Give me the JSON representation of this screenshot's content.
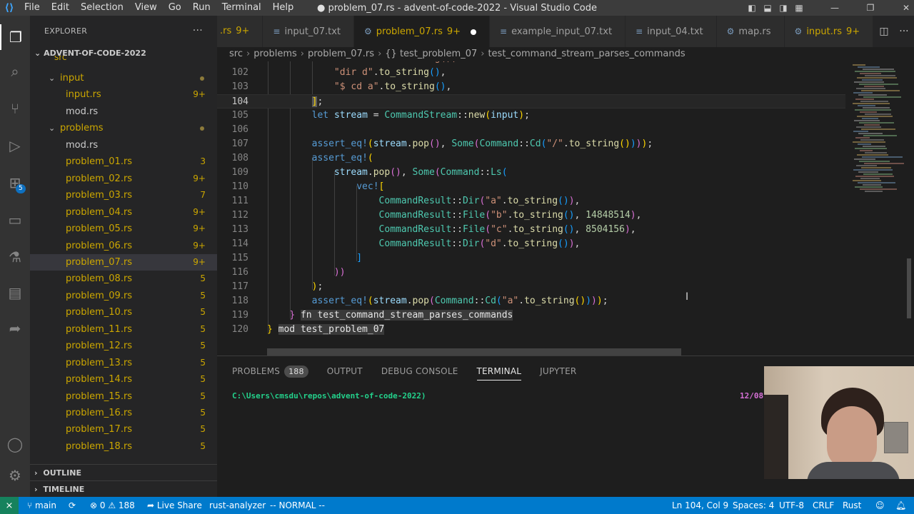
{
  "window": {
    "title": "● problem_07.rs - advent-of-code-2022 - Visual Studio Code",
    "menu": [
      "File",
      "Edit",
      "Selection",
      "View",
      "Go",
      "Run",
      "Terminal",
      "Help"
    ]
  },
  "explorer": {
    "header": "EXPLORER",
    "more": "···",
    "root": "ADVENT-OF-CODE-2022",
    "partial_top": "src",
    "rows": [
      {
        "name": "input",
        "kind": "folder",
        "indent": 1,
        "count": "",
        "warn": true
      },
      {
        "name": "input.rs",
        "kind": "file",
        "indent": 2,
        "count": "9+",
        "warn": true
      },
      {
        "name": "mod.rs",
        "kind": "file",
        "indent": 2,
        "count": "",
        "warn": false
      },
      {
        "name": "problems",
        "kind": "folder",
        "indent": 1,
        "count": "",
        "warn": true
      },
      {
        "name": "mod.rs",
        "kind": "file",
        "indent": 2,
        "count": "",
        "warn": false
      },
      {
        "name": "problem_01.rs",
        "kind": "file",
        "indent": 2,
        "count": "3",
        "warn": true
      },
      {
        "name": "problem_02.rs",
        "kind": "file",
        "indent": 2,
        "count": "9+",
        "warn": true
      },
      {
        "name": "problem_03.rs",
        "kind": "file",
        "indent": 2,
        "count": "7",
        "warn": true
      },
      {
        "name": "problem_04.rs",
        "kind": "file",
        "indent": 2,
        "count": "9+",
        "warn": true
      },
      {
        "name": "problem_05.rs",
        "kind": "file",
        "indent": 2,
        "count": "9+",
        "warn": true
      },
      {
        "name": "problem_06.rs",
        "kind": "file",
        "indent": 2,
        "count": "9+",
        "warn": true
      },
      {
        "name": "problem_07.rs",
        "kind": "file",
        "indent": 2,
        "count": "9+",
        "warn": true,
        "selected": true
      },
      {
        "name": "problem_08.rs",
        "kind": "file",
        "indent": 2,
        "count": "5",
        "warn": true
      },
      {
        "name": "problem_09.rs",
        "kind": "file",
        "indent": 2,
        "count": "5",
        "warn": true
      },
      {
        "name": "problem_10.rs",
        "kind": "file",
        "indent": 2,
        "count": "5",
        "warn": true
      },
      {
        "name": "problem_11.rs",
        "kind": "file",
        "indent": 2,
        "count": "5",
        "warn": true
      },
      {
        "name": "problem_12.rs",
        "kind": "file",
        "indent": 2,
        "count": "5",
        "warn": true
      },
      {
        "name": "problem_13.rs",
        "kind": "file",
        "indent": 2,
        "count": "5",
        "warn": true
      },
      {
        "name": "problem_14.rs",
        "kind": "file",
        "indent": 2,
        "count": "5",
        "warn": true
      },
      {
        "name": "problem_15.rs",
        "kind": "file",
        "indent": 2,
        "count": "5",
        "warn": true
      },
      {
        "name": "problem_16.rs",
        "kind": "file",
        "indent": 2,
        "count": "5",
        "warn": true
      },
      {
        "name": "problem_17.rs",
        "kind": "file",
        "indent": 2,
        "count": "5",
        "warn": true
      },
      {
        "name": "problem_18.rs",
        "kind": "file",
        "indent": 2,
        "count": "5",
        "warn": true
      }
    ],
    "sections": [
      "OUTLINE",
      "TIMELINE"
    ]
  },
  "tabs": [
    {
      "label": ".rs",
      "count": "9+",
      "active": false,
      "warn": true
    },
    {
      "label": "input_07.txt",
      "count": "",
      "active": false,
      "warn": false
    },
    {
      "label": "problem_07.rs",
      "count": "9+",
      "active": true,
      "warn": true,
      "dirty": true
    },
    {
      "label": "example_input_07.txt",
      "count": "",
      "active": false,
      "warn": false
    },
    {
      "label": "input_04.txt",
      "count": "",
      "active": false,
      "warn": false
    },
    {
      "label": "map.rs",
      "count": "",
      "active": false,
      "warn": false
    },
    {
      "label": "input.rs",
      "count": "9+",
      "active": false,
      "warn": true
    }
  ],
  "breadcrumb": [
    "src",
    "problems",
    "problem_07.rs",
    "{} test_problem_07",
    "test_command_stream_parses_commands"
  ],
  "editor": {
    "current_line": "104",
    "line_numbers": [
      "102",
      "103",
      "104",
      "105",
      "106",
      "107",
      "108",
      "109",
      "110",
      "111",
      "112",
      "113",
      "114",
      "115",
      "116",
      "117",
      "118",
      "119",
      "120"
    ]
  },
  "panel": {
    "tabs": [
      "PROBLEMS",
      "OUTPUT",
      "DEBUG CONSOLE",
      "TERMINAL",
      "JUPYTER"
    ],
    "problems_count": "188",
    "active_tab": "TERMINAL",
    "terminal_prompt": "C:\\Users\\cmsdu\\repos\\advent-of-code-2022)",
    "terminal_date": "12/08"
  },
  "statusbar": {
    "branch": "main",
    "errors": "0",
    "warnings": "188",
    "live_share": "Live Share",
    "analyzer": "rust-analyzer",
    "mode": "-- NORMAL --",
    "position": "Ln 104, Col 9",
    "spaces": "Spaces: 4",
    "encoding": "UTF-8",
    "eol": "CRLF",
    "language": "Rust"
  },
  "colors": {
    "accent": "#007acc",
    "remote": "#16825d",
    "warning": "#cca700",
    "terminal_green": "#23d18b"
  },
  "icons": [
    "explorer-icon",
    "search-icon",
    "source-control-icon",
    "run-debug-icon",
    "extensions-icon",
    "remote-explorer-icon",
    "testing-icon",
    "notebook-icon",
    "live-share-icon",
    "accounts-icon",
    "manage-gear-icon"
  ]
}
